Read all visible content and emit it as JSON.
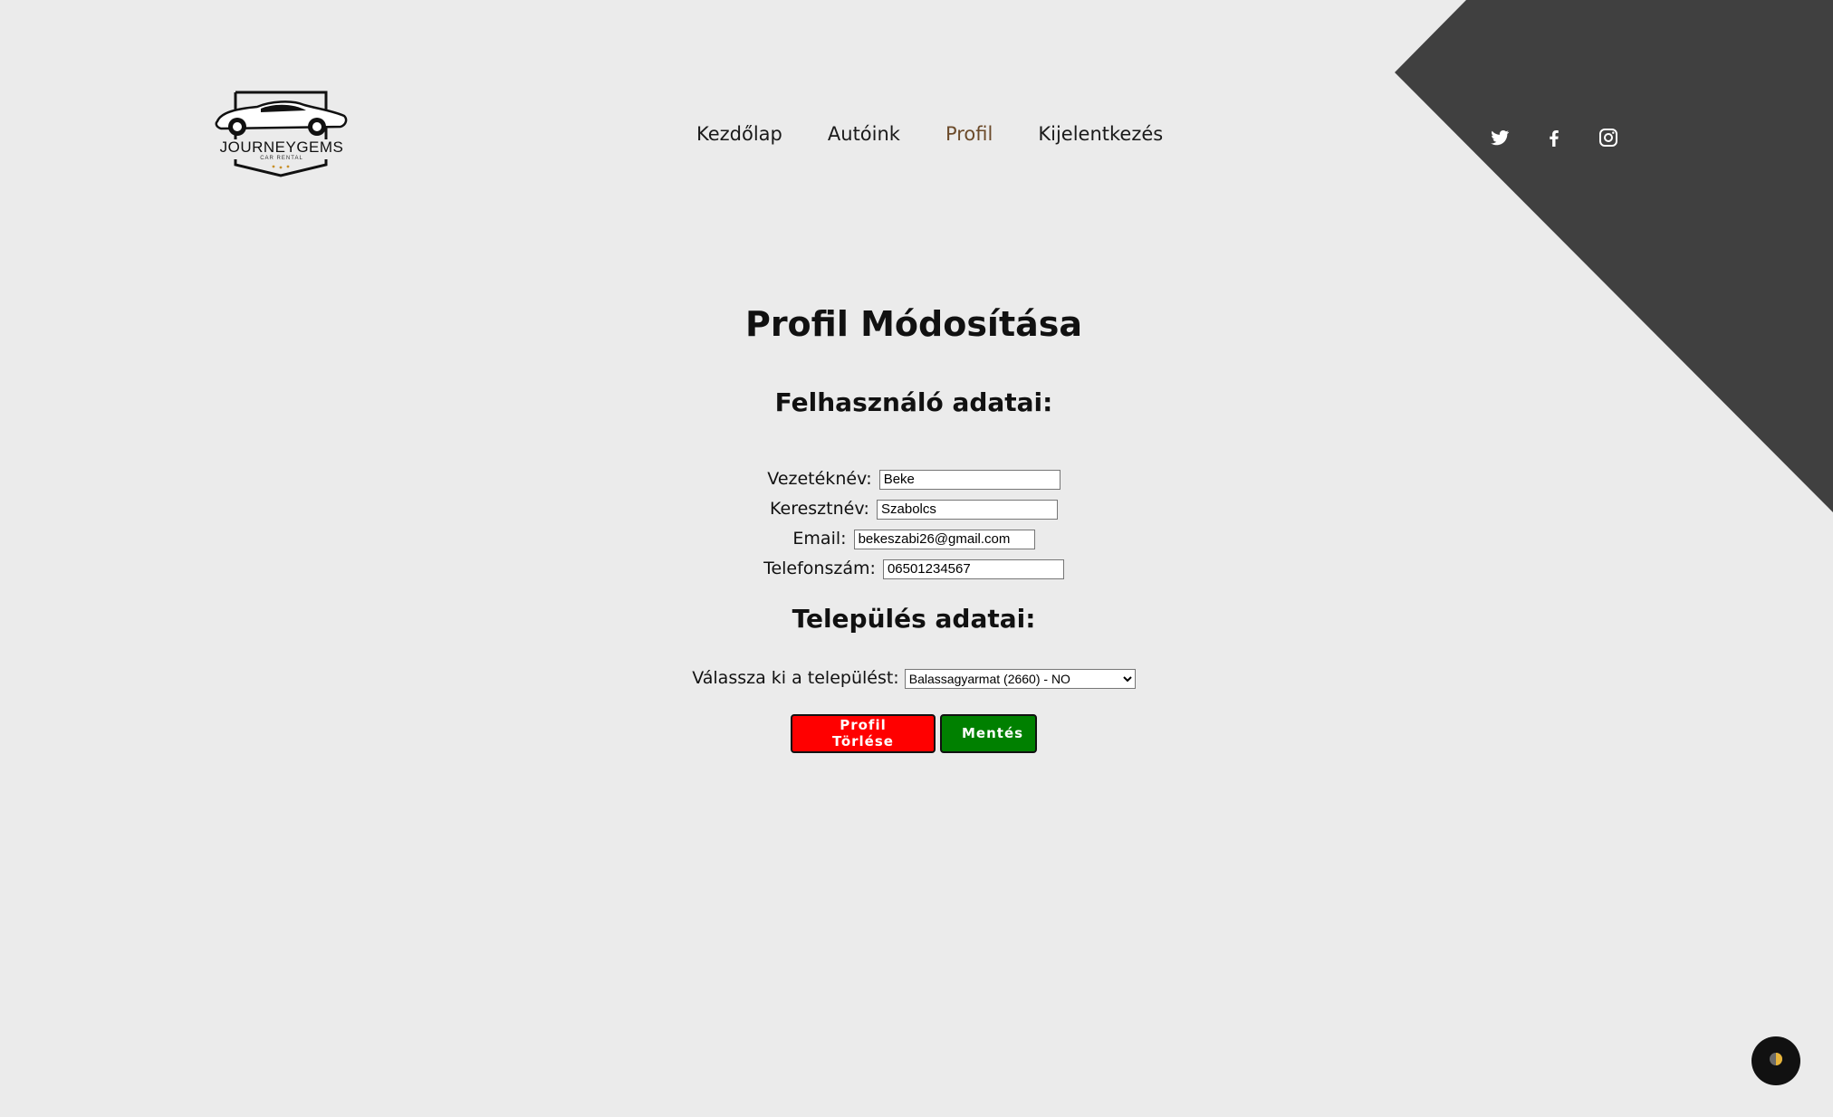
{
  "brand": {
    "name": "JOURNEYGEMS",
    "tagline": "CAR RENTAL"
  },
  "nav": {
    "items": [
      {
        "label": "Kezdőlap"
      },
      {
        "label": "Autóink"
      },
      {
        "label": "Profil"
      },
      {
        "label": "Kijelentkezés"
      }
    ],
    "active": "Profil"
  },
  "social": [
    "twitter-icon",
    "facebook-icon",
    "instagram-icon"
  ],
  "page": {
    "title": "Profil Módosítása",
    "user_section_title": "Felhasználó adatai:",
    "fields": {
      "last_name": {
        "label": "Vezetéknév:",
        "value": "Beke"
      },
      "first_name": {
        "label": "Keresztnév:",
        "value": "Szabolcs"
      },
      "email": {
        "label": "Email:",
        "value": "bekeszabi26@gmail.com"
      },
      "phone": {
        "label": "Telefonszám:",
        "value": "06501234567"
      }
    },
    "city_section_title": "Település adatai:",
    "city": {
      "label": "Válassza ki a települést:",
      "selected": "Balassagyarmat (2660) - NO"
    },
    "buttons": {
      "delete": "Profil Törlése",
      "save": "Mentés"
    }
  },
  "colors": {
    "background": "#ebebeb",
    "corner": "#404040",
    "active_nav": "#6b4a2a",
    "delete": "#ff0000",
    "save": "#008000"
  }
}
